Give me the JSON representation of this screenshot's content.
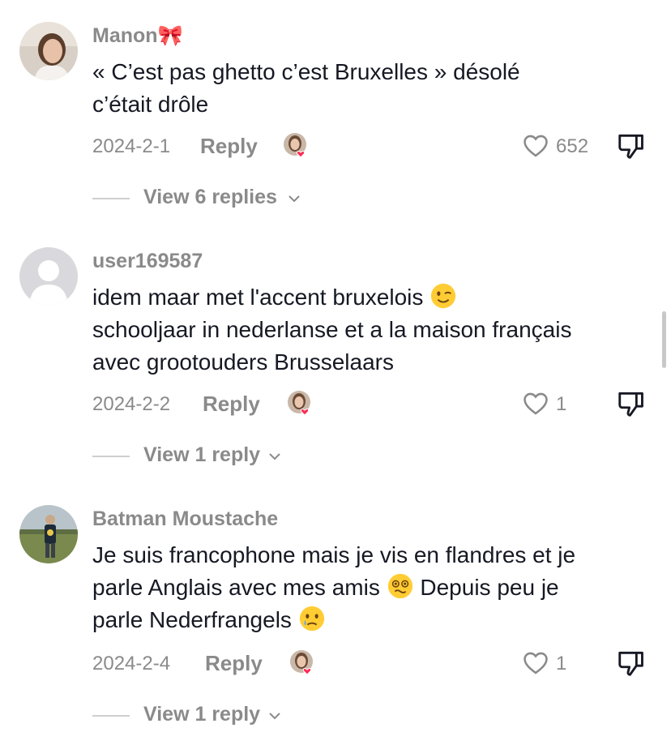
{
  "comments": [
    {
      "username": "Manon🎀",
      "lines": [
        "« C’est pas ghetto c’est Bruxelles » désolé",
        "c’était drôle"
      ],
      "date": "2024-2-1",
      "reply_label": "Reply",
      "likes": "652",
      "view_replies": "View 6 replies"
    },
    {
      "username": "user169587",
      "lines": [
        "idem maar met l'accent bruxelois",
        "schooljaar in nederlanse et a la maison français",
        "avec grootouders Brusselaars"
      ],
      "date": "2024-2-2",
      "reply_label": "Reply",
      "likes": "1",
      "view_replies": "View 1 reply"
    },
    {
      "username": "Batman Moustache",
      "lines": [
        "Je suis francophone mais je vis en flandres et je",
        "parle Anglais avec mes amis",
        "Depuis peu je",
        "parle Nederfrangels"
      ],
      "date": "2024-2-4",
      "reply_label": "Reply",
      "likes": "1",
      "view_replies": "View 1 reply"
    }
  ],
  "icons": {
    "like": "heart-outline-icon",
    "dislike": "thumbs-down-icon",
    "creator_liked": "creator-liked-avatar-icon",
    "expand": "chevron-down-icon",
    "wink": "winking-face-emoji",
    "dizzy": "dizzy-face-emoji",
    "sad": "sad-tear-face-emoji"
  },
  "colors": {
    "text": "#161823",
    "muted": "#8a8a8a",
    "heart_badge": "#fe2c55"
  }
}
